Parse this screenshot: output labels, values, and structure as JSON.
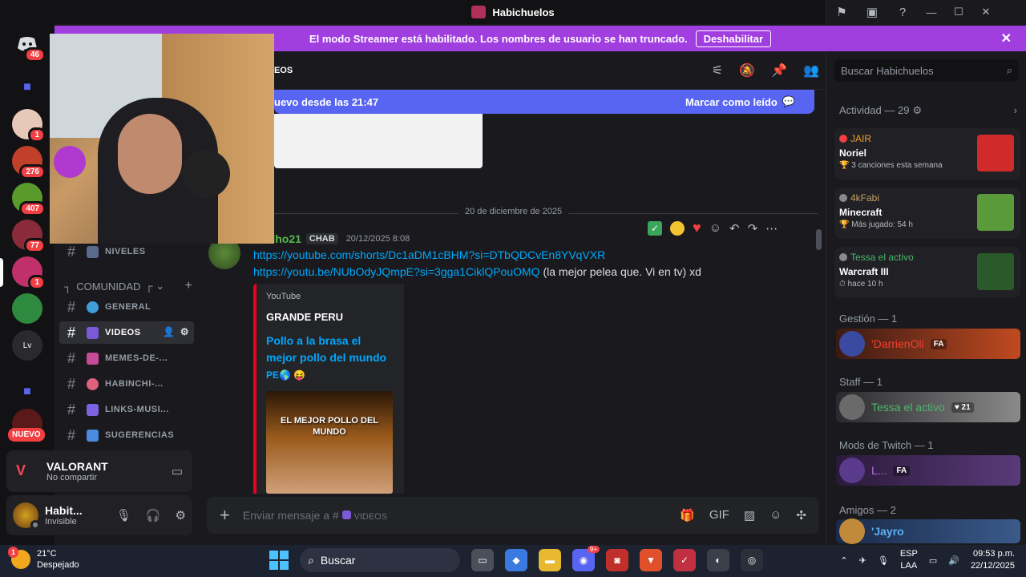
{
  "titlebar": {
    "title": "Habichuelos"
  },
  "banner": {
    "text": "El modo Streamer está habilitado. Los nombres de usuario se han truncado.",
    "button": "Deshabilitar",
    "close": "✕"
  },
  "rail": {
    "home_badge": "46",
    "badges": [
      "1",
      "276",
      "407",
      "77",
      "1"
    ],
    "new_label": "NUEVO",
    "lv": "Lv"
  },
  "channels": {
    "niveles": "NIVELES",
    "category": "COMUNIDAD",
    "items": [
      {
        "name": "GENERAL",
        "emoji_color": "#3f9ed8"
      },
      {
        "name": "VIDEOS",
        "emoji_color": "#7b5ad8"
      },
      {
        "name": "MEMES-DE-...",
        "emoji_color": "#c84a9a"
      },
      {
        "name": "HABINCHI-...",
        "emoji_color": "#e06080"
      },
      {
        "name": "LINKS-MUSI...",
        "emoji_color": "#7c62e0"
      },
      {
        "name": "SUGERENCIAS",
        "emoji_color": "#4a8ae0"
      }
    ]
  },
  "activity_card": {
    "game": "VALORANT",
    "status": "No compartir"
  },
  "user": {
    "name": "Habit...",
    "status": "Invisible"
  },
  "header": {
    "channel": "EOS",
    "new_since": "uevo desde las 21:47",
    "mark_read": "Marcar como leído"
  },
  "messages": {
    "date_divider": "20 de diciembre de 2025",
    "author": "rilho21",
    "tag": "CHAB",
    "timestamp": "20/12/2025 8:08",
    "link1": "https://youtube.com/shorts/Dc1aDM1cBHM?si=DTbQDCvEn8YVqVXR",
    "link2": "https://youtu.be/NUbOdyJQmpE?si=3gga1CiklQPouOMQ",
    "link2_suffix": " (la mejor pelea que. Vi en tv) xd",
    "embed": {
      "provider": "YouTube",
      "author": "GRANDE PERU",
      "title": "Pollo a la brasa el mejor pollo del mundo",
      "title_suffix": "PE🌎 😝",
      "thumb_caption": "EL MEJOR POLLO DEL MUNDO"
    }
  },
  "composer": {
    "placeholder": "Enviar mensaje a #",
    "channel": "VIDEOS"
  },
  "right": {
    "search_placeholder": "Buscar Habichuelos",
    "activity_title": "Actividad — 29",
    "activity": [
      {
        "who": "JAIR",
        "who_color": "#f0a030",
        "game": "Noriel",
        "detail": "3 canciones esta semana",
        "art": "#d02a2a"
      },
      {
        "who": "4kFabi",
        "who_color": "#c8a060",
        "game": "Minecraft",
        "detail": "Más jugado: 54 h",
        "art": "#5a9a3a"
      },
      {
        "who": "Tessa el activo",
        "who_color": "#4ab86a",
        "game": "Warcraft III",
        "detail": "hace 10 h",
        "art": "#2a5a2a"
      }
    ],
    "groups": [
      {
        "title": "Gestión — 1",
        "member": "'DarrienOli",
        "tag": "FA",
        "color": "#f04030",
        "bg": "linear-gradient(90deg,#3a1a14,#c04a20)"
      },
      {
        "title": "Staff — 1",
        "member": "Tessa el activo",
        "tag": "♥ 21",
        "color": "#4ab86a",
        "bg": "linear-gradient(90deg,#2a2a2e,#8a8a8a)"
      },
      {
        "title": "Mods de Twitch — 1",
        "member": "L...",
        "tag": "FA",
        "color": "#b070e0",
        "bg": "linear-gradient(90deg,#2a1a3a,#5a3a7a)"
      },
      {
        "title": "Amigos — 2",
        "member": "'Jayro",
        "tag": "",
        "color": "#5ab0f0",
        "bg": "linear-gradient(90deg,#1a2a4a,#3a5a8a)"
      }
    ]
  },
  "taskbar": {
    "temp": "21°C",
    "weather": "Despejado",
    "weather_badge": "1",
    "search": "Buscar",
    "lang1": "ESP",
    "lang2": "LAA",
    "time": "09:53 p.m.",
    "date": "22/12/2025",
    "discord_badge": "9+"
  }
}
